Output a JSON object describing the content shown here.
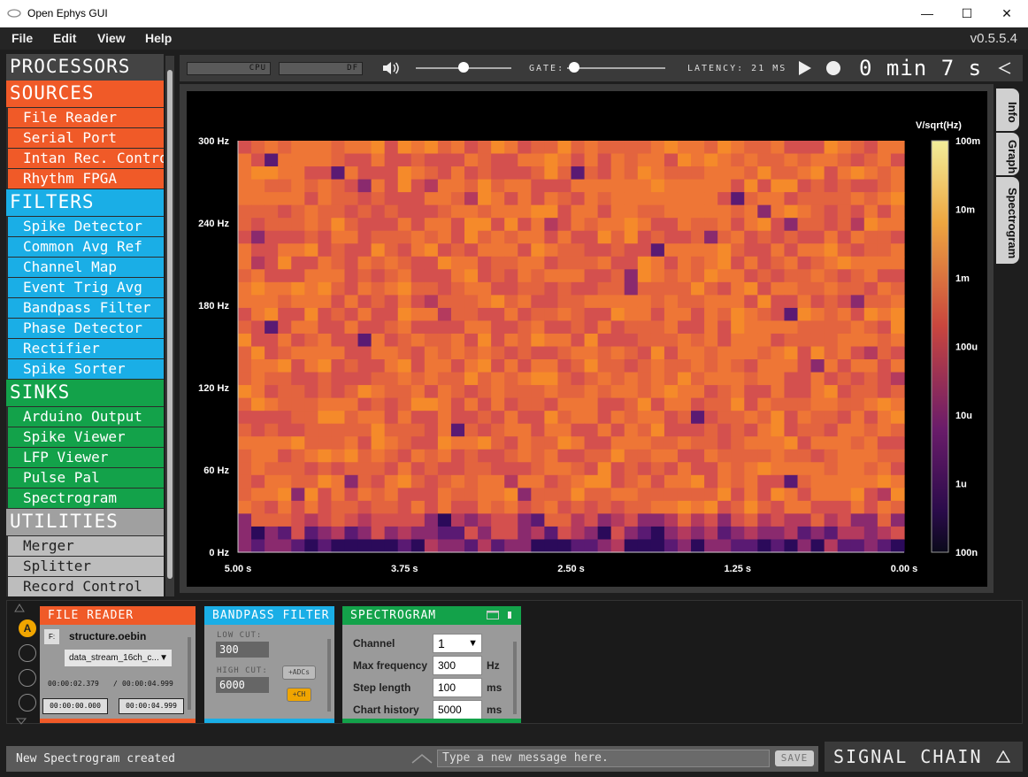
{
  "window": {
    "title": "Open Ephys GUI",
    "minimize": "—",
    "maximize": "☐",
    "close": "✕"
  },
  "menu": {
    "file": "File",
    "edit": "Edit",
    "view": "View",
    "help": "Help",
    "version": "v0.5.5.4"
  },
  "processors": {
    "title": "PROCESSORS",
    "sources": {
      "header": "SOURCES",
      "items": [
        "File Reader",
        "Serial Port",
        "Intan Rec. Controller",
        "Rhythm FPGA"
      ]
    },
    "filters": {
      "header": "FILTERS",
      "items": [
        "Spike Detector",
        "Common Avg Ref",
        "Channel Map",
        "Event Trig Avg",
        "Bandpass Filter",
        "Phase Detector",
        "Rectifier",
        "Spike Sorter"
      ]
    },
    "sinks": {
      "header": "SINKS",
      "items": [
        "Arduino Output",
        "Spike Viewer",
        "LFP Viewer",
        "Pulse Pal",
        "Spectrogram"
      ]
    },
    "utilities": {
      "header": "UTILITIES",
      "items": [
        "Merger",
        "Splitter",
        "Record Control"
      ]
    }
  },
  "control": {
    "cpu_label": "CPU",
    "df_label": "DF",
    "volume_level": 0.5,
    "gate_label": "GATE:",
    "gate_level": 0.0,
    "latency": "LATENCY: 21 MS",
    "clock": "0 min 7 s"
  },
  "tabs": [
    "Info",
    "Graph",
    "Spectrogram"
  ],
  "colors": {
    "source": "#f05a28",
    "filter": "#1aaee6",
    "sink": "#13a24a",
    "utility": "#a0a0a0"
  },
  "chart_data": {
    "type": "heatmap",
    "ylabel_ticks": [
      "300 Hz",
      "240 Hz",
      "180 Hz",
      "120 Hz",
      "60 Hz",
      "0 Hz"
    ],
    "xlabel_ticks": [
      "5.00 s",
      "3.75 s",
      "2.50 s",
      "1.25 s",
      "0.00 s"
    ],
    "x_range": [
      5.0,
      0.0
    ],
    "y_range": [
      0,
      300
    ],
    "colorbar": {
      "label": "V/sqrt(Hz)",
      "ticks": [
        "100m",
        "10m",
        "1m",
        "100u",
        "10u",
        "1u",
        "100n"
      ]
    },
    "note_cells": "dense noise-like power map mostly ~1m, darker near 0 Hz"
  },
  "editors": {
    "file_reader": {
      "title": "FILE READER",
      "file": "structure.oebin",
      "stream": "data_stream_16ch_c...",
      "time_cur": "00:00:02.379",
      "time_sep": "/",
      "time_total": "00:00:04.999",
      "start": "00:00:00.000",
      "end": "00:00:04.999",
      "f_btn": "F:"
    },
    "bandpass": {
      "title": "BANDPASS FILTER",
      "low_label": "LOW CUT:",
      "low": "300",
      "high_label": "HIGH CUT:",
      "high": "6000",
      "adcs": "+ADCs",
      "ch": "+CH"
    },
    "spectrogram": {
      "title": "SPECTROGRAM",
      "channel_label": "Channel",
      "channel": "1",
      "maxf_label": "Max frequency",
      "maxf": "300",
      "maxf_unit": "Hz",
      "step_label": "Step length",
      "step": "100",
      "step_unit": "ms",
      "hist_label": "Chart history",
      "hist": "5000",
      "hist_unit": "ms"
    },
    "slot_label": "A"
  },
  "status": {
    "message": "New Spectrogram created",
    "placeholder": "Type a new message here.",
    "save": "SAVE",
    "signal_chain": "SIGNAL CHAIN"
  }
}
